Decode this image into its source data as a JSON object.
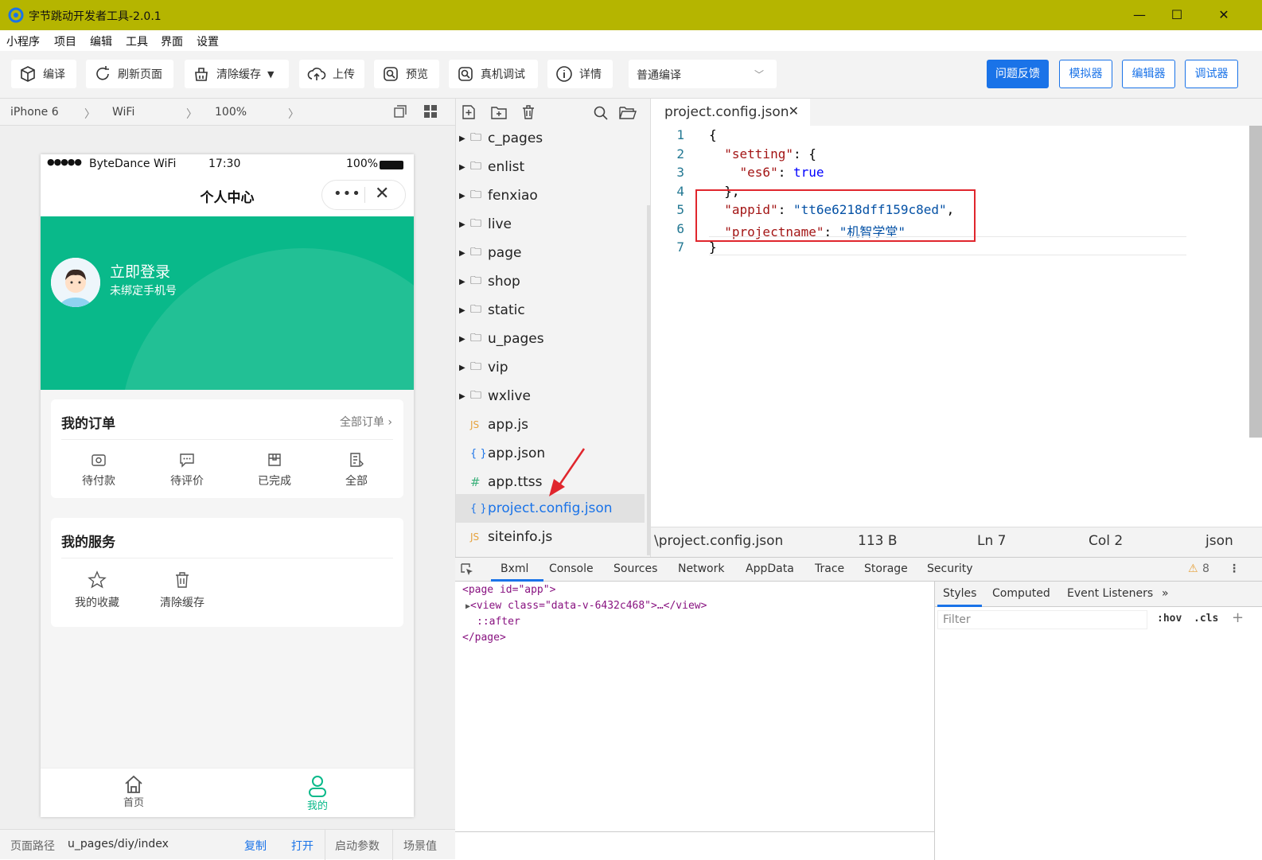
{
  "app": {
    "title": "字节跳动开发者工具-2.0.1",
    "accent": "#1a73e8"
  },
  "menu": [
    "小程序",
    "项目",
    "编辑",
    "工具",
    "界面",
    "设置"
  ],
  "toolbar": {
    "compile": "编译",
    "refresh": "刷新页面",
    "clear_cache": "清除缓存",
    "upload": "上传",
    "preview": "预览",
    "remote_debug": "真机调试",
    "details": "详情",
    "compile_mode": "普通编译",
    "feedback": "问题反馈",
    "simulator": "模拟器",
    "editor": "编辑器",
    "debugger": "调试器"
  },
  "simbar": {
    "device": "iPhone 6",
    "network": "WiFi",
    "zoom": "100%"
  },
  "phone": {
    "signal": "●●●●●",
    "carrier": "ByteDance WiFi",
    "time": "17:30",
    "battery": "100%",
    "nav_title": "个人中心",
    "login": "立即登录",
    "phone_bind": "未绑定手机号",
    "orders_title": "我的订单",
    "orders_more": "全部订单",
    "orders": [
      "待付款",
      "待评价",
      "已完成",
      "全部"
    ],
    "services_title": "我的服务",
    "services": [
      "我的收藏",
      "清除缓存"
    ],
    "tabs": [
      "首页",
      "我的"
    ],
    "hero_color": "#09b98a"
  },
  "pathbar": {
    "label": "页面路径",
    "path": "u_pages/diy/index",
    "copy": "复制",
    "open": "打开",
    "launch": "启动参数",
    "scene": "场景值"
  },
  "tree": {
    "folders": [
      "c_pages",
      "enlist",
      "fenxiao",
      "live",
      "page",
      "shop",
      "static",
      "u_pages",
      "vip",
      "wxlive"
    ],
    "files": [
      {
        "icon": "JS",
        "name": "app.js"
      },
      {
        "icon": "{ }",
        "name": "app.json"
      },
      {
        "icon": "#",
        "name": "app.ttss"
      },
      {
        "icon": "{ }",
        "name": "project.config.json"
      },
      {
        "icon": "JS",
        "name": "siteinfo.js"
      }
    ]
  },
  "editor": {
    "tab": "project.config.json",
    "lines": [
      "1",
      "2",
      "3",
      "4",
      "5",
      "6",
      "7"
    ],
    "code": {
      "l1": "{",
      "l2_key": "\"setting\"",
      "l2_rest": ": {",
      "l3_key": "\"es6\"",
      "l3_val": "true",
      "l4": "},",
      "l5_key": "\"appid\"",
      "l5_val": "\"tt6e6218dff159c8ed\"",
      "l6_key": "\"projectname\"",
      "l6_val": "\"机智学堂\"",
      "l7": "}"
    },
    "status": {
      "path": "\\project.config.json",
      "size": "113 B",
      "ln": "Ln 7",
      "col": "Col 2",
      "lang": "json"
    }
  },
  "devtools": {
    "tabs": [
      "Bxml",
      "Console",
      "Sources",
      "Network",
      "AppData",
      "Trace",
      "Storage",
      "Security"
    ],
    "warnings": "8",
    "dom": {
      "page_open": "<page id=\"app\">",
      "view": "<view class=\"data-v-6432c468\">…</view>",
      "after": "::after",
      "page_close": "</page>"
    },
    "styles_tabs": [
      "Styles",
      "Computed",
      "Event Listeners"
    ],
    "filter_placeholder": "Filter",
    "hov": ":hov",
    "cls": ".cls"
  }
}
